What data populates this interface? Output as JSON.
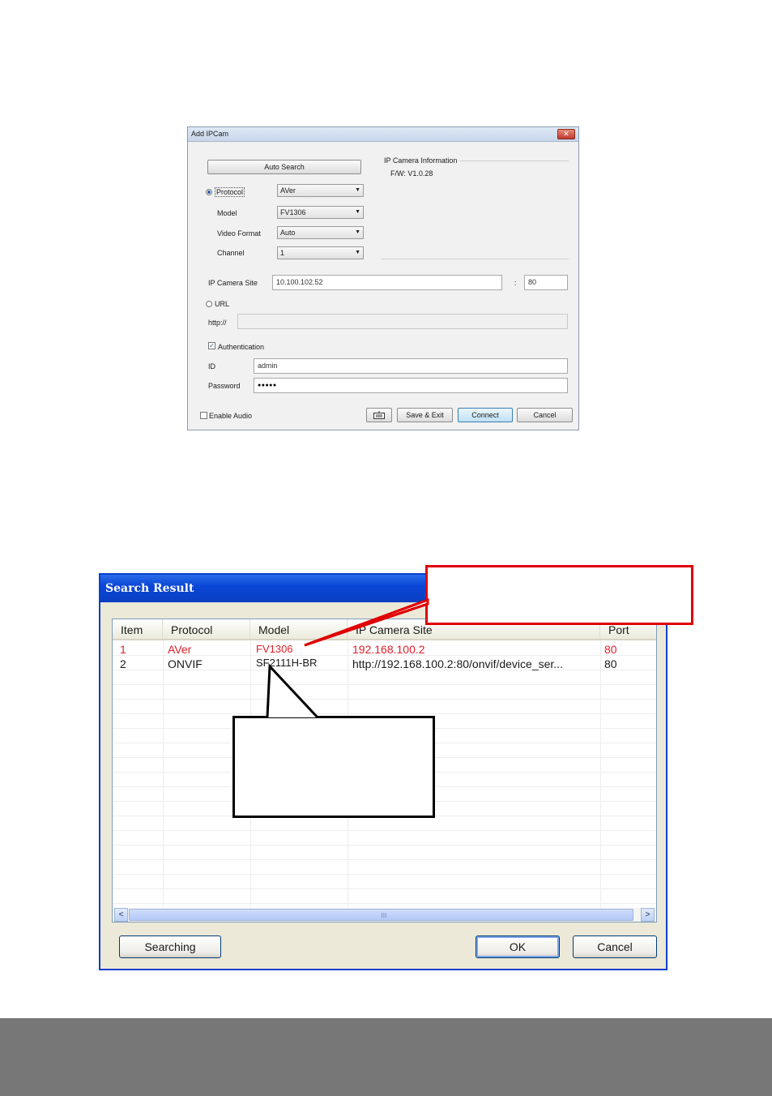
{
  "ipcam_dialog": {
    "title": "Add IPCam",
    "close_glyph": "✕",
    "auto_search": "Auto Search",
    "protocol_label": "Protocol",
    "protocol_value": "AVer",
    "model_label": "Model",
    "model_value": "FV1306",
    "video_format_label": "Video Format",
    "video_format_value": "Auto",
    "channel_label": "Channel",
    "channel_value": "1",
    "info_heading": "IP Camera Information",
    "fw": "F/W: V1.0.28",
    "ip_site_label": "IP Camera Site",
    "ip_site_value": "10.100.102.52",
    "port_sep": ":",
    "port_value": "80",
    "url_label": "URL",
    "http_label": "http://",
    "auth_label": "Authentication",
    "id_label": "ID",
    "id_value": "admin",
    "password_label": "Password",
    "password_value": "●●●●●",
    "enable_audio": "Enable Audio",
    "save_exit": "Save & Exit",
    "connect": "Connect",
    "cancel": "Cancel"
  },
  "search_dialog": {
    "title": "Search Result",
    "columns": [
      "Item",
      "Protocol",
      "Model",
      "IP Camera Site",
      "Port"
    ],
    "rows": [
      [
        "1",
        "AVer",
        "FV1306",
        "192.168.100.2",
        "80"
      ],
      [
        "2",
        "ONVIF",
        "SF2111H-BR",
        "http://192.168.100.2:80/onvif/device_ser...",
        "80"
      ]
    ],
    "scroll_grip": "III",
    "searching": "Searching",
    "ok": "OK",
    "cancel": "Cancel"
  },
  "colors": {
    "highlight_row": "#e0202a",
    "callout_red": "#e00000",
    "xp_title": "#0a46d6",
    "footer": "#777777"
  }
}
